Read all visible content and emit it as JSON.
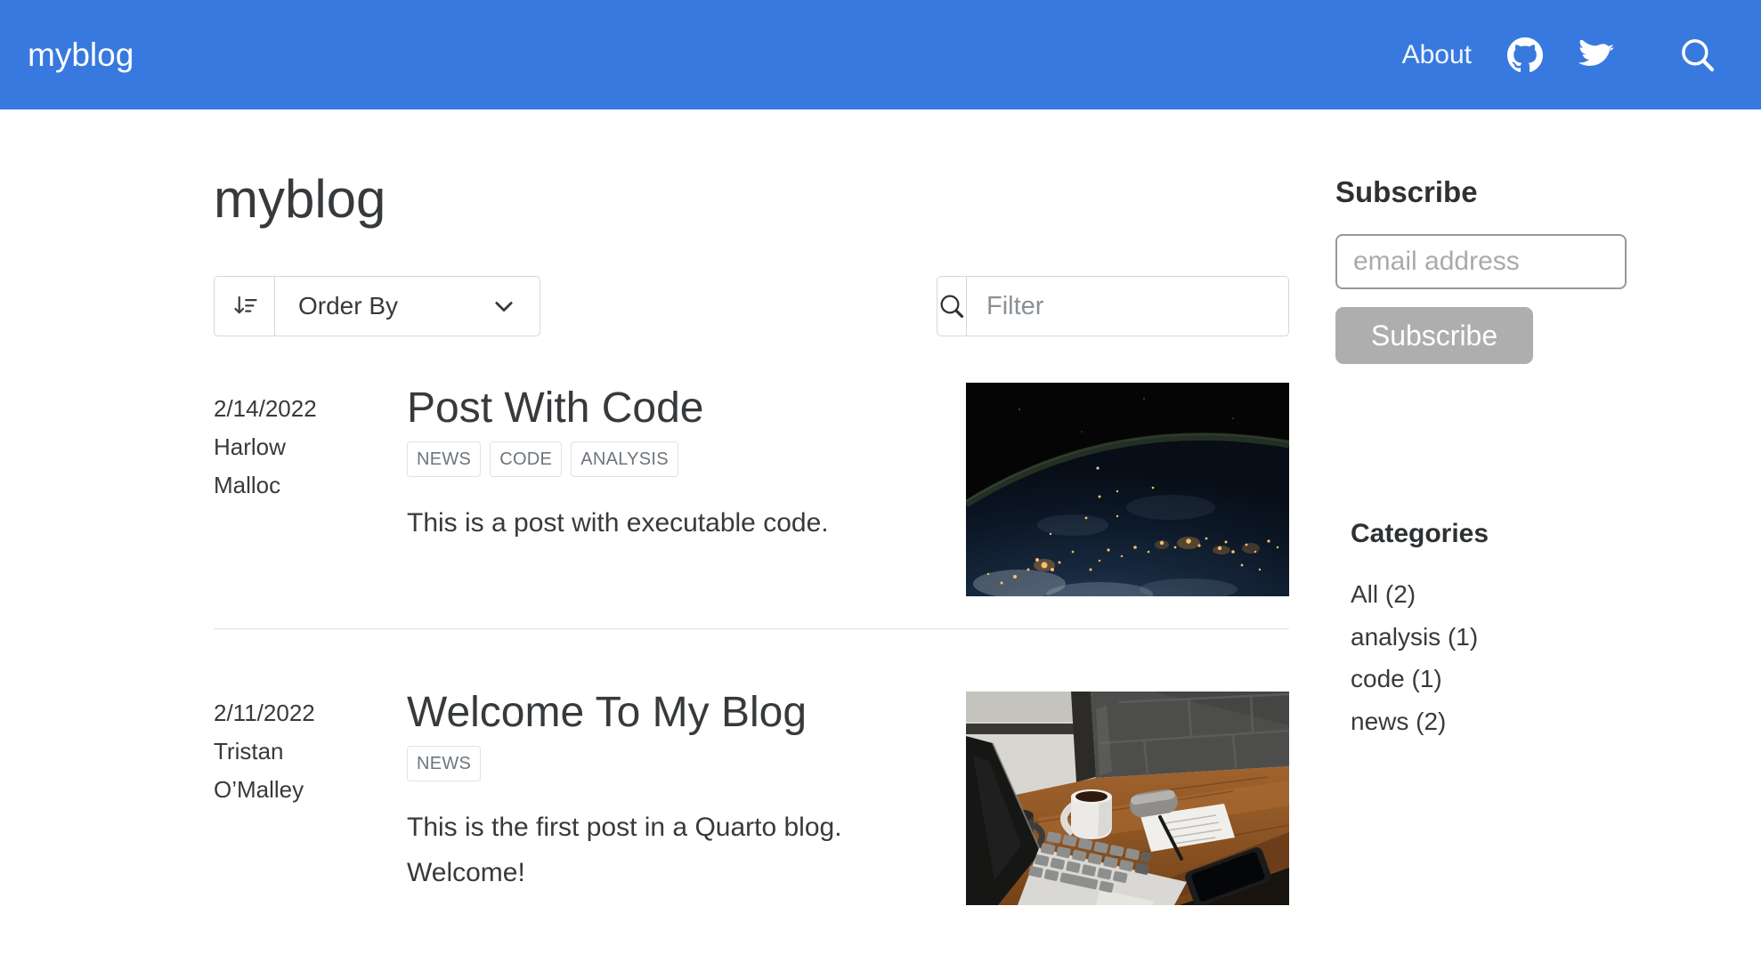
{
  "navbar": {
    "brand": "myblog",
    "about_label": "About",
    "icons": [
      "github-icon",
      "twitter-icon",
      "search-icon"
    ]
  },
  "page": {
    "title": "myblog"
  },
  "controls": {
    "order_by_label": "Order By",
    "order_by_icon": "sort-down-icon",
    "chevron_icon": "chevron-down-icon",
    "filter_icon": "search-icon",
    "filter_placeholder": "Filter"
  },
  "posts": [
    {
      "date": "2/14/2022",
      "author": "Harlow Malloc",
      "title": "Post With Code",
      "categories": [
        "NEWS",
        "CODE",
        "ANALYSIS"
      ],
      "description": "This is a post with executable code.",
      "image": "earth-at-night-from-space"
    },
    {
      "date": "2/11/2022",
      "author": "Tristan O’Malley",
      "title": "Welcome To My Blog",
      "categories": [
        "NEWS"
      ],
      "description": "This is the first post in a Quarto blog. Welcome!",
      "image": "desk-with-laptop-coffee-notepad-phone"
    }
  ],
  "sidebar": {
    "subscribe_heading": "Subscribe",
    "email_placeholder": "email address",
    "subscribe_button": "Subscribe",
    "categories_heading": "Categories",
    "categories": [
      "All (2)",
      "analysis (1)",
      "code (1)",
      "news (2)"
    ]
  },
  "colors": {
    "navbar_bg": "#3879df",
    "text": "#373a3c",
    "pill_text": "#6d757c",
    "pill_border": "#dee2e6",
    "divider": "#dde1e5",
    "button_bg": "#afaeae"
  }
}
